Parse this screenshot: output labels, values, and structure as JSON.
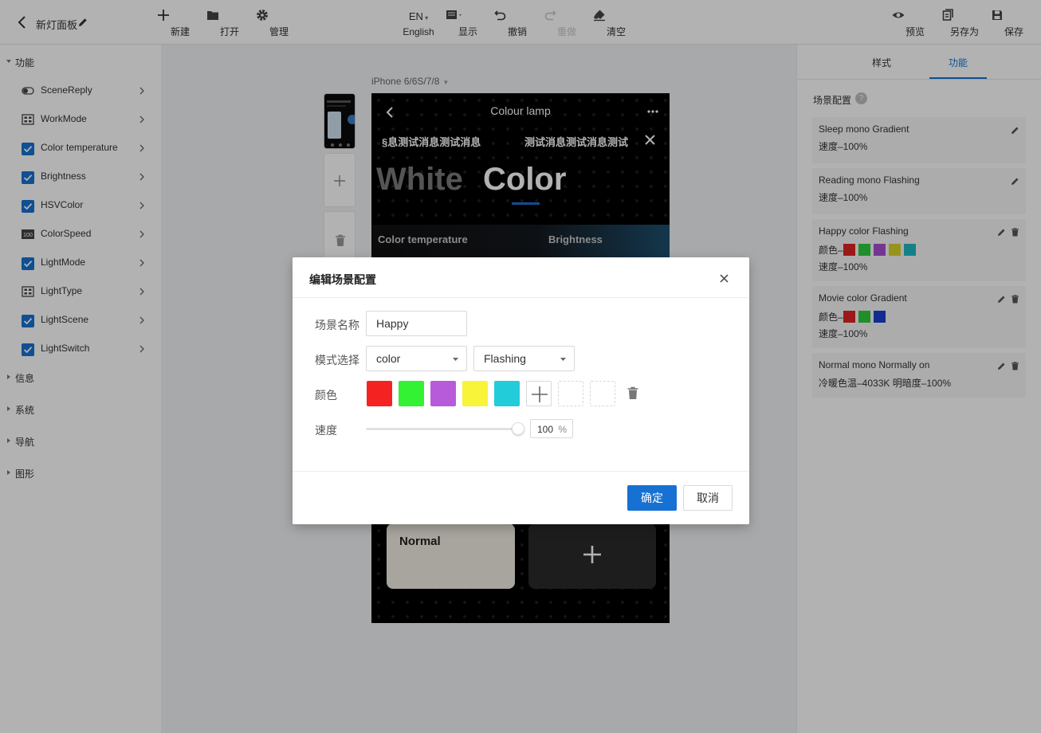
{
  "toolbar": {
    "panel_title": "新灯面板",
    "new_label": "新建",
    "open_label": "打开",
    "manage_label": "管理",
    "lang_code": "EN",
    "lang_label": "English",
    "display_label": "显示",
    "undo_label": "撤销",
    "redo_label": "重做",
    "clear_label": "清空",
    "preview_label": "预览",
    "save_as_label": "另存为",
    "save_label": "保存"
  },
  "sidebar": {
    "sections": [
      "功能",
      "信息",
      "系统",
      "导航",
      "图形"
    ],
    "items": [
      {
        "label": "SceneReply",
        "icon": "toggle-icon"
      },
      {
        "label": "WorkMode",
        "icon": "grid-icon"
      },
      {
        "label": "Color temperature",
        "icon": "checkbox-checked-icon"
      },
      {
        "label": "Brightness",
        "icon": "checkbox-checked-icon"
      },
      {
        "label": "HSVColor",
        "icon": "checkbox-checked-icon"
      },
      {
        "label": "ColorSpeed",
        "icon": "number-icon"
      },
      {
        "label": "LightMode",
        "icon": "checkbox-checked-icon"
      },
      {
        "label": "LightType",
        "icon": "grid-icon"
      },
      {
        "label": "LightScene",
        "icon": "checkbox-checked-icon"
      },
      {
        "label": "LightSwitch",
        "icon": "checkbox-checked-icon"
      }
    ],
    "number_icon_text": "100"
  },
  "canvas": {
    "device": "iPhone 6/6S/7/8"
  },
  "phone": {
    "title": "Colour lamp",
    "marquee_1": "§息测试消息测试消息",
    "marquee_2": "测试消息测试消息测试",
    "tab_white": "White",
    "tab_color": "Color",
    "label_temperature": "Color temperature",
    "label_brightness": "Brightness",
    "scene_card_normal": "Normal"
  },
  "right_panel": {
    "tab_style": "样式",
    "tab_function": "功能",
    "section_title": "场景配置",
    "help_glyph": "?",
    "scenes": [
      {
        "name": "Sleep mono Gradient",
        "speed": "速度–100%"
      },
      {
        "name": "Reading mono Flashing",
        "speed": "速度–100%"
      },
      {
        "name": "Happy color Flashing",
        "color_label": "颜色–",
        "colors": [
          "#e02424",
          "#2fcc3b",
          "#a550d0",
          "#d8d52a",
          "#20b8c4"
        ],
        "speed": "速度–100%"
      },
      {
        "name": "Movie color Gradient",
        "color_label": "颜色–",
        "colors": [
          "#e02424",
          "#2fcc3b",
          "#1a3fd0"
        ],
        "speed": "速度–100%"
      },
      {
        "name": "Normal mono Normally on",
        "detail": "冷暖色温–4033K 明暗度–100%"
      }
    ]
  },
  "modal": {
    "title": "编辑场景配置",
    "name_label": "场景名称",
    "name_value": "Happy",
    "mode_label": "模式选择",
    "mode_value": "color",
    "effect_value": "Flashing",
    "color_label": "颜色",
    "colors": [
      "#f52222",
      "#33f233",
      "#b85bdb",
      "#f8f43a",
      "#22ccd9"
    ],
    "speed_label": "速度",
    "speed_value": "100",
    "speed_unit": "%",
    "speed_fraction": 1.0,
    "ok_label": "确定",
    "cancel_label": "取消"
  }
}
